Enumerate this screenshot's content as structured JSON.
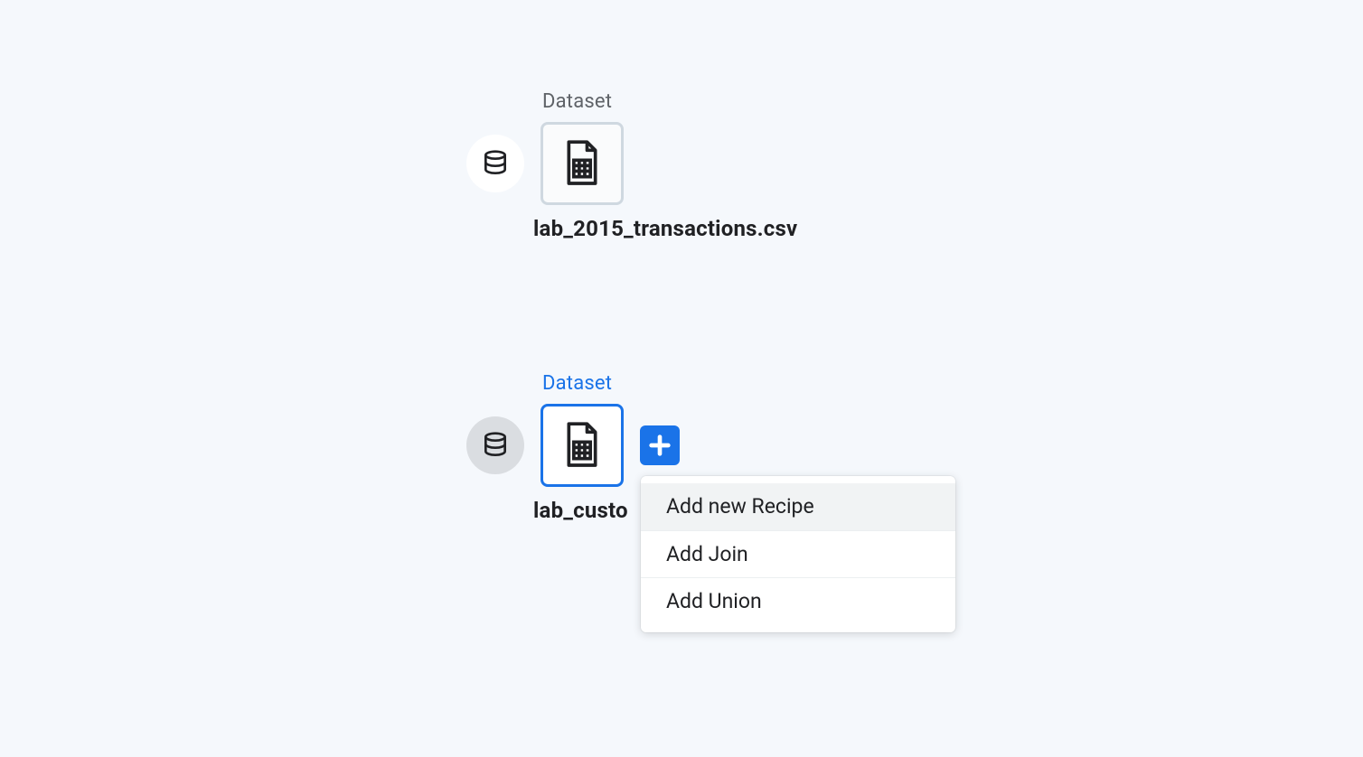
{
  "nodes": [
    {
      "type_label": "Dataset",
      "name": "lab_2015_transactions.csv",
      "active": false
    },
    {
      "type_label": "Dataset",
      "name": "lab_custo",
      "active": true
    }
  ],
  "menu": {
    "items": [
      {
        "label": "Add new Recipe",
        "hover": true
      },
      {
        "label": "Add Join",
        "hover": false
      },
      {
        "label": "Add Union",
        "hover": false
      }
    ]
  },
  "colors": {
    "accent": "#1a73e8",
    "bg": "#f5f8fc",
    "text": "#202124"
  }
}
